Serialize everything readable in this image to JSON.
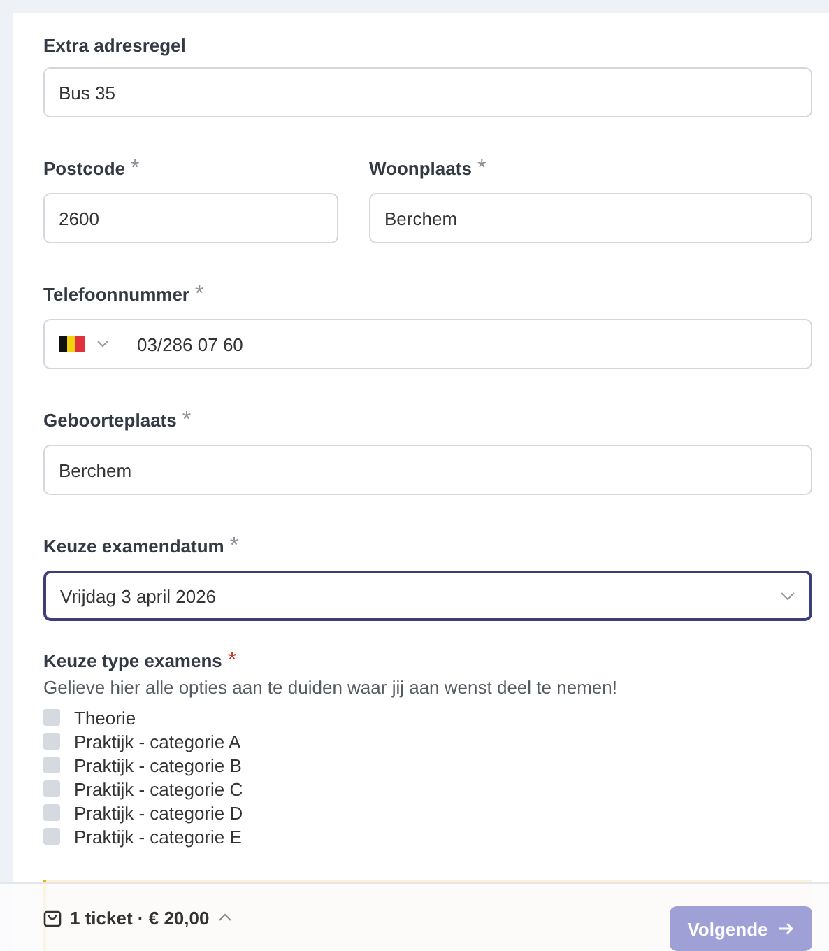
{
  "fields": [
    {
      "kind": "text",
      "label": "Extra adresregel",
      "value": "Bus 35"
    },
    {
      "kind": "pair",
      "items": [
        {
          "label": "Postcode",
          "mark": "*",
          "value": "2600"
        },
        {
          "label": "Woonplaats",
          "mark": "*",
          "value": "Berchem"
        }
      ]
    },
    {
      "kind": "phone",
      "label": "Telefoonnummer",
      "mark": "*",
      "value": "03/286 07 60"
    },
    {
      "kind": "text",
      "label": "Geboorteplaats",
      "mark": "*",
      "value": "Berchem"
    },
    {
      "kind": "select",
      "label": "Keuze examendatum",
      "mark": "*",
      "value": "Vrijdag 3 april 2026",
      "focused": true
    }
  ],
  "exam_types": {
    "label": "Keuze type examens",
    "mark": "*",
    "help": "Gelieve hier alle opties aan te duiden waar jij aan wenst deel te nemen!",
    "options": [
      {
        "label": "Theorie",
        "checked": false
      },
      {
        "label": "Praktijk - categorie A",
        "checked": false
      },
      {
        "label": "Praktijk - categorie B",
        "checked": false
      },
      {
        "label": "Praktijk - categorie C",
        "checked": false
      },
      {
        "label": "Praktijk - categorie D",
        "checked": false
      },
      {
        "label": "Praktijk - categorie E",
        "checked": false
      }
    ]
  },
  "warning": {
    "kind": "notice"
  },
  "footer": {
    "summary": "1 ticket · € 20,00",
    "next_button": "Volgende",
    "next_disabled": true
  }
}
